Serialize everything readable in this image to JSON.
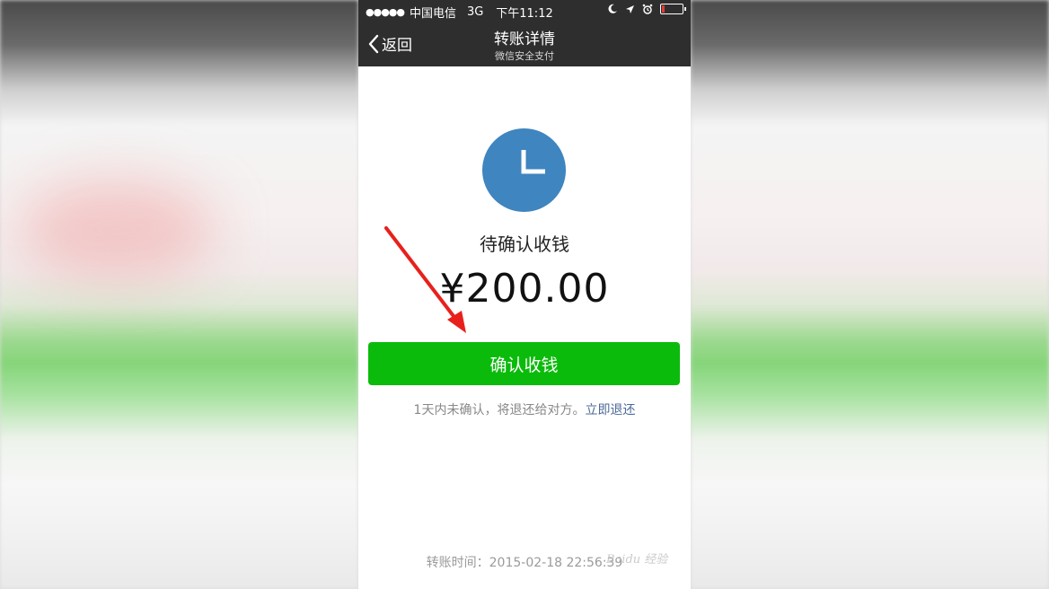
{
  "statusbar": {
    "carrier": "中国电信",
    "network": "3G",
    "time": "下午11:12"
  },
  "navbar": {
    "back_label": "返回",
    "title": "转账详情",
    "subtitle": "微信安全支付"
  },
  "transfer": {
    "status": "待确认收钱",
    "amount": "¥200.00",
    "confirm_label": "确认收钱",
    "notice": "1天内未确认，将退还给对方。",
    "refund_link": "立即退还",
    "time_label": "转账时间：",
    "time_value": "2015-02-18 22:56:39"
  },
  "colors": {
    "confirm_button": "#0bbb0b",
    "clock_icon": "#3f85bf",
    "navbar": "#2e2e2e",
    "link": "#4c6a9a",
    "annotation_arrow": "#e8201c"
  },
  "icons": {
    "status": "clock-icon",
    "back": "chevron-left-icon"
  }
}
